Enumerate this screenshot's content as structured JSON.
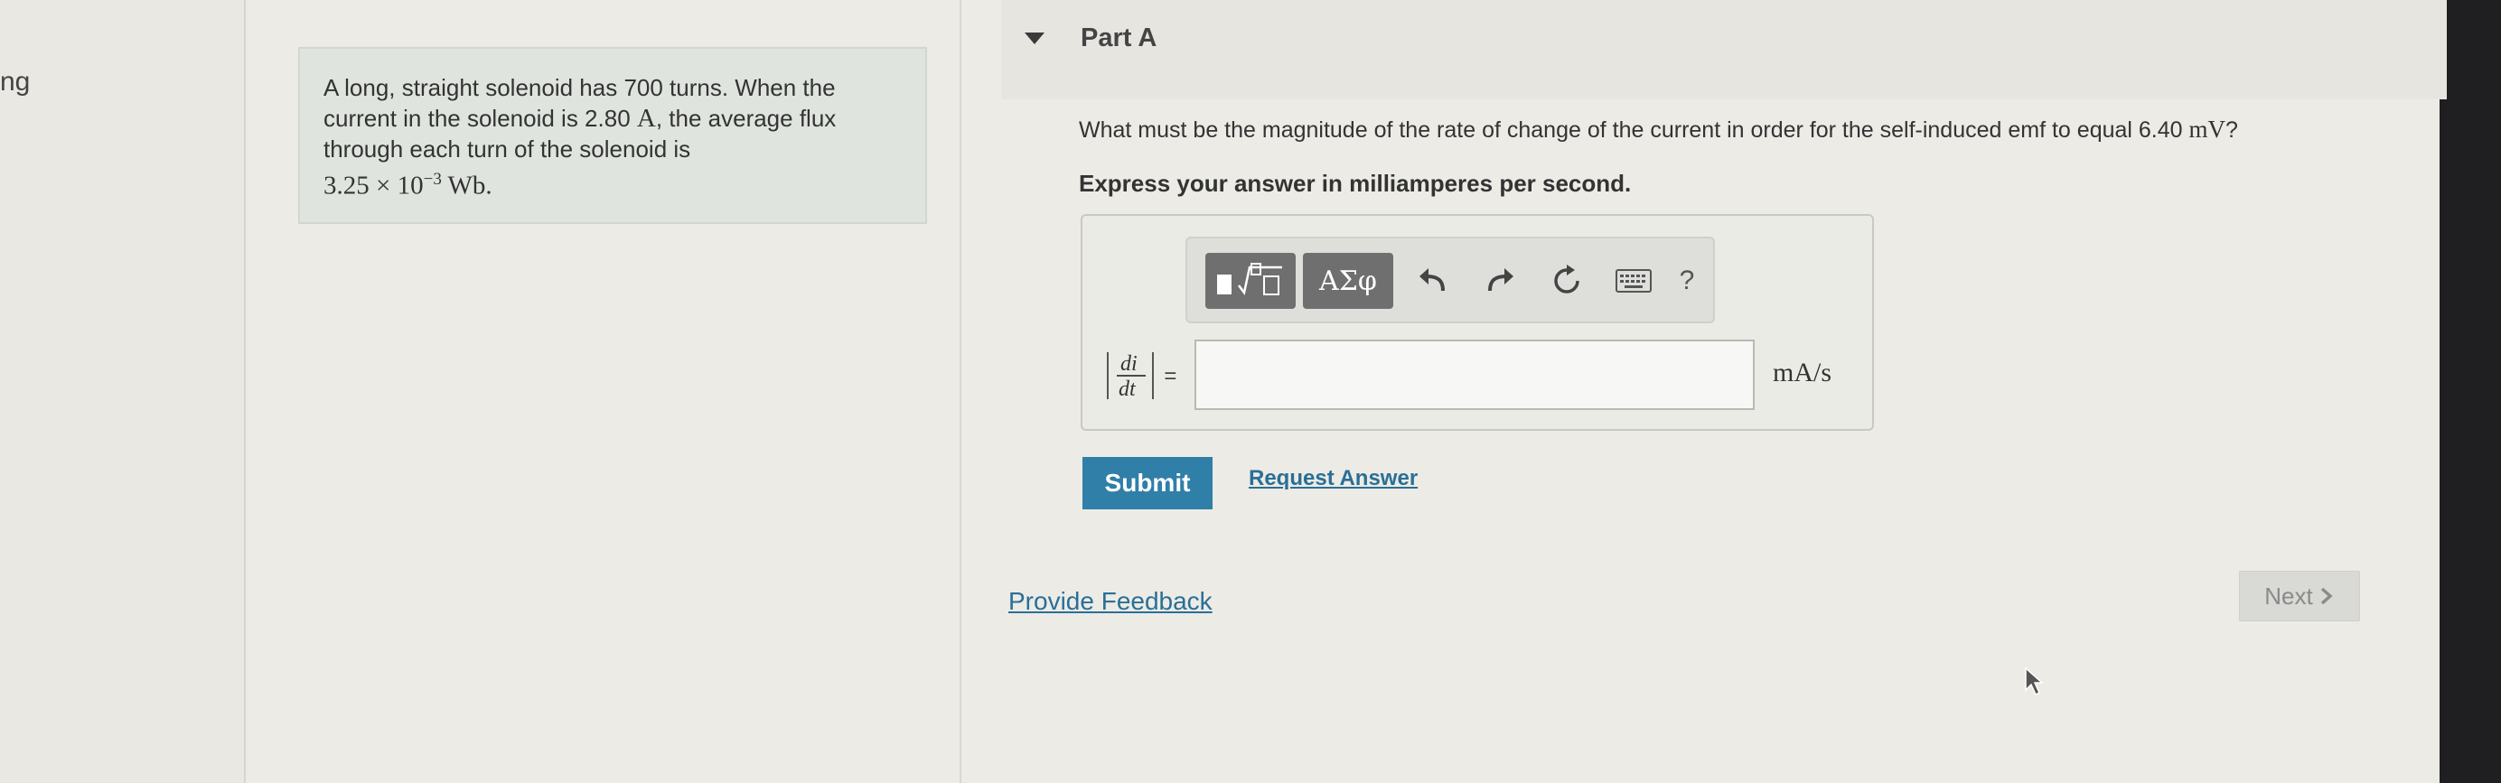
{
  "left_fragment": "ng",
  "problem": {
    "line1": "A long, straight solenoid has 700 turns. When the",
    "line2a": "current in the solenoid is 2.80 ",
    "line2_unit": "A",
    "line2b": ", the average flux",
    "line3": "through each turn of the solenoid is",
    "flux_mantissa": "3.25 × 10",
    "flux_exp": "−3",
    "flux_unit": " Wb."
  },
  "part": {
    "title": "Part A"
  },
  "question": {
    "text": "What must be the magnitude of the rate of change of the current in order for the self-induced emf to equal 6.40 ",
    "unit": "mV",
    "end": "?"
  },
  "instruction": "Express your answer in milliamperes per second.",
  "toolbar": {
    "greek_label": "ΑΣφ",
    "help_label": "?"
  },
  "answer": {
    "lhs_num": "di",
    "lhs_den": "dt",
    "equals": "=",
    "value": "",
    "unit": "mA/s"
  },
  "buttons": {
    "submit": "Submit",
    "request_answer": "Request Answer",
    "provide_feedback": "Provide Feedback",
    "next": "Next"
  }
}
